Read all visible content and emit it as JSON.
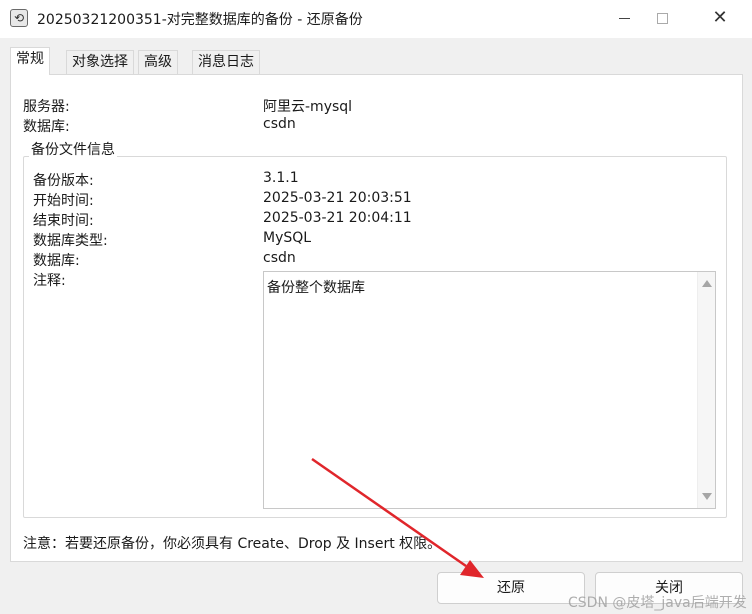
{
  "window": {
    "title": "20250321200351-对完整数据库的备份 - 还原备份",
    "app_icon": "restore-icon",
    "minimize_icon": "minimize-icon",
    "maximize_icon": "maximize-icon",
    "close_glyph": "✕"
  },
  "tabs": [
    {
      "label": "常规",
      "active": true
    },
    {
      "label": "对象选择",
      "active": false
    },
    {
      "label": "高级",
      "active": false
    },
    {
      "label": "消息日志",
      "active": false
    }
  ],
  "general": {
    "server_label": "服务器:",
    "server_value": "阿里云-mysql",
    "database_label": "数据库:",
    "database_value": "csdn"
  },
  "backup_info": {
    "group_title": "备份文件信息",
    "version_label": "备份版本:",
    "version_value": "3.1.1",
    "start_label": "开始时间:",
    "start_value": "2025-03-21 20:03:51",
    "end_label": "结束时间:",
    "end_value": "2025-03-21 20:04:11",
    "dbtype_label": "数据库类型:",
    "dbtype_value": "MySQL",
    "db_label": "数据库:",
    "db_value": "csdn",
    "comment_label": "注释:",
    "comment_value": "备份整个数据库"
  },
  "footer": {
    "note": "注意：若要还原备份，你必须具有 Create、Drop 及 Insert 权限。",
    "restore_button": "还原",
    "close_button": "关闭"
  },
  "watermark": "CSDN @皮塔_java后端开发",
  "colors": {
    "annotation_arrow": "#e0262b",
    "dialog_bg": "#f0f0f0"
  }
}
